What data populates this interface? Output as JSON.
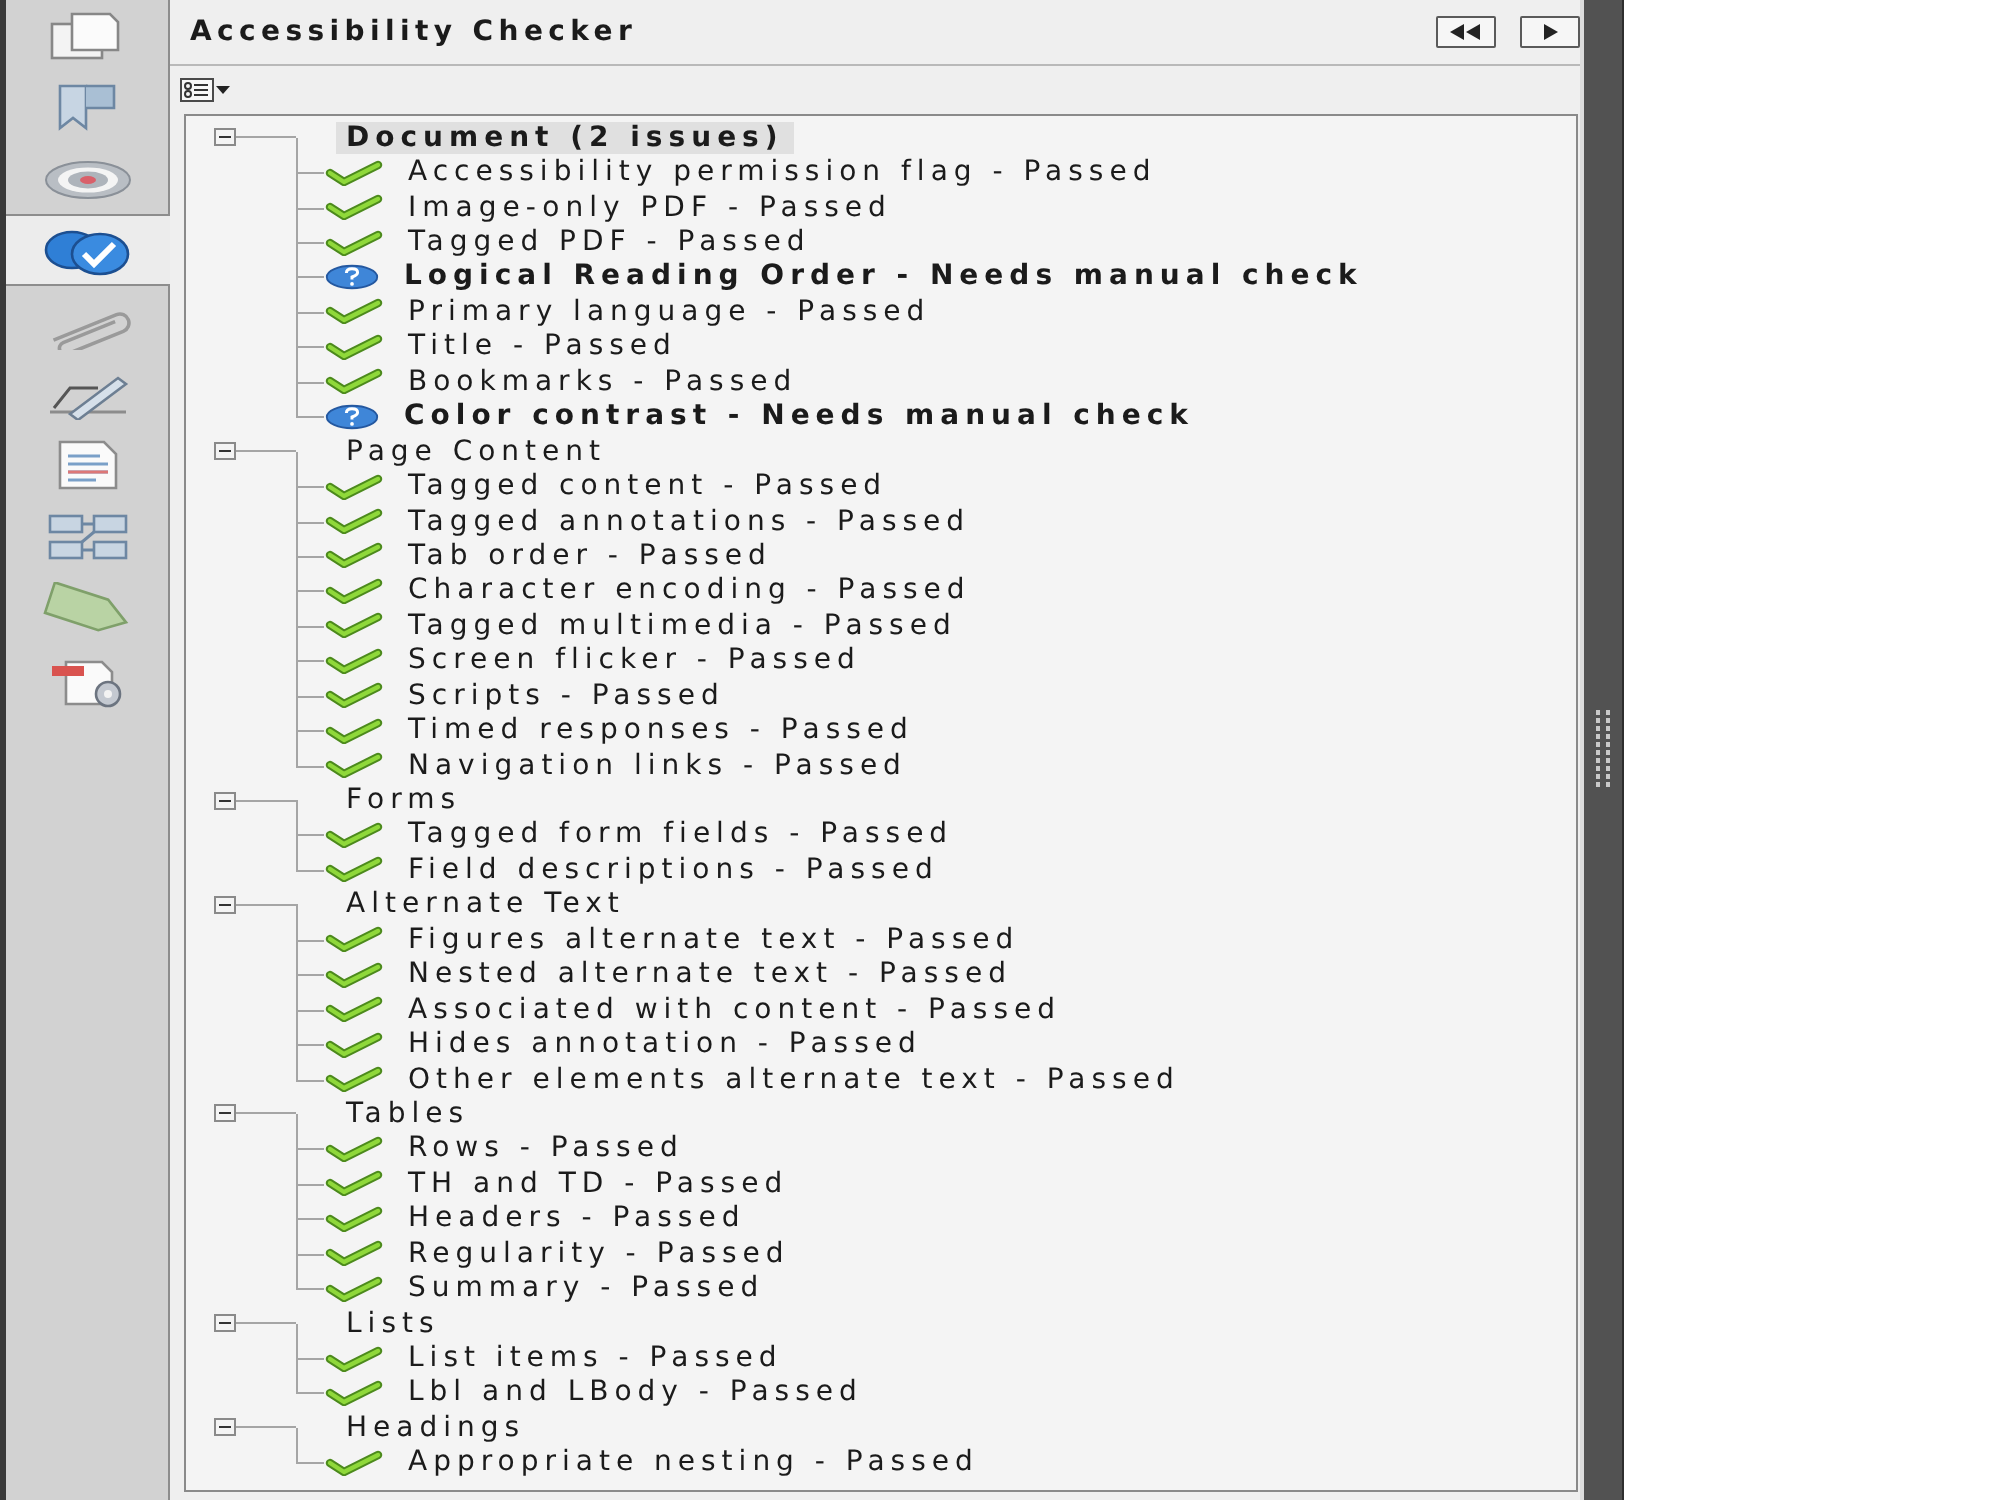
{
  "sidebar": {
    "items": [
      {
        "selected": false
      },
      {
        "selected": false
      },
      {
        "selected": false
      },
      {
        "selected": true
      },
      {
        "selected": false
      },
      {
        "selected": false
      },
      {
        "selected": false
      },
      {
        "selected": false
      },
      {
        "selected": false
      },
      {
        "selected": false
      }
    ]
  },
  "panel": {
    "title": "Accessibility Checker"
  },
  "tree": {
    "groups": [
      {
        "label": "Document (2 issues)",
        "selected": true,
        "flagged": true,
        "expanded": true,
        "children": [
          {
            "label": "Accessibility permission flag - Passed",
            "kind": "passed",
            "selected": false
          },
          {
            "label": "Image-only PDF - Passed",
            "kind": "passed",
            "selected": false
          },
          {
            "label": "Tagged PDF - Passed",
            "kind": "passed",
            "selected": false
          },
          {
            "label": "Logical Reading Order - Needs manual check",
            "kind": "manual",
            "selected": false
          },
          {
            "label": "Primary language - Passed",
            "kind": "passed",
            "selected": false
          },
          {
            "label": "Title - Passed",
            "kind": "passed",
            "selected": false
          },
          {
            "label": "Bookmarks - Passed",
            "kind": "passed",
            "selected": false
          },
          {
            "label": "Color contrast - Needs manual check",
            "kind": "manual",
            "selected": false
          }
        ]
      },
      {
        "label": "Page Content",
        "selected": false,
        "flagged": false,
        "expanded": true,
        "children": [
          {
            "label": "Tagged content - Passed",
            "kind": "passed",
            "selected": false
          },
          {
            "label": "Tagged annotations - Passed",
            "kind": "passed",
            "selected": false
          },
          {
            "label": "Tab order - Passed",
            "kind": "passed",
            "selected": false
          },
          {
            "label": "Character encoding - Passed",
            "kind": "passed",
            "selected": false
          },
          {
            "label": "Tagged multimedia - Passed",
            "kind": "passed",
            "selected": false
          },
          {
            "label": "Screen flicker - Passed",
            "kind": "passed",
            "selected": false
          },
          {
            "label": "Scripts - Passed",
            "kind": "passed",
            "selected": false
          },
          {
            "label": "Timed responses - Passed",
            "kind": "passed",
            "selected": false
          },
          {
            "label": "Navigation links - Passed",
            "kind": "passed",
            "selected": false
          }
        ]
      },
      {
        "label": "Forms",
        "selected": false,
        "flagged": false,
        "expanded": true,
        "children": [
          {
            "label": "Tagged form fields - Passed",
            "kind": "passed",
            "selected": false
          },
          {
            "label": "Field descriptions - Passed",
            "kind": "passed",
            "selected": false
          }
        ]
      },
      {
        "label": "Alternate Text",
        "selected": false,
        "flagged": false,
        "expanded": true,
        "children": [
          {
            "label": "Figures alternate text - Passed",
            "kind": "passed",
            "selected": false
          },
          {
            "label": "Nested alternate text - Passed",
            "kind": "passed",
            "selected": false
          },
          {
            "label": "Associated with content - Passed",
            "kind": "passed",
            "selected": false
          },
          {
            "label": "Hides annotation - Passed",
            "kind": "passed",
            "selected": false
          },
          {
            "label": "Other elements alternate text - Passed",
            "kind": "passed",
            "selected": false
          }
        ]
      },
      {
        "label": "Tables",
        "selected": false,
        "flagged": false,
        "expanded": true,
        "children": [
          {
            "label": "Rows - Passed",
            "kind": "passed",
            "selected": false
          },
          {
            "label": "TH and TD - Passed",
            "kind": "passed",
            "selected": false
          },
          {
            "label": "Headers - Passed",
            "kind": "passed",
            "selected": false
          },
          {
            "label": "Regularity - Passed",
            "kind": "passed",
            "selected": false
          },
          {
            "label": "Summary - Passed",
            "kind": "passed",
            "selected": false
          }
        ]
      },
      {
        "label": "Lists",
        "selected": false,
        "flagged": false,
        "expanded": true,
        "children": [
          {
            "label": "List items - Passed",
            "kind": "passed",
            "selected": false
          },
          {
            "label": "Lbl and LBody - Passed",
            "kind": "passed",
            "selected": false
          }
        ]
      },
      {
        "label": "Headings",
        "selected": false,
        "flagged": false,
        "expanded": true,
        "children": [
          {
            "label": "Appropriate nesting - Passed",
            "kind": "passed",
            "selected": false
          }
        ]
      }
    ]
  }
}
